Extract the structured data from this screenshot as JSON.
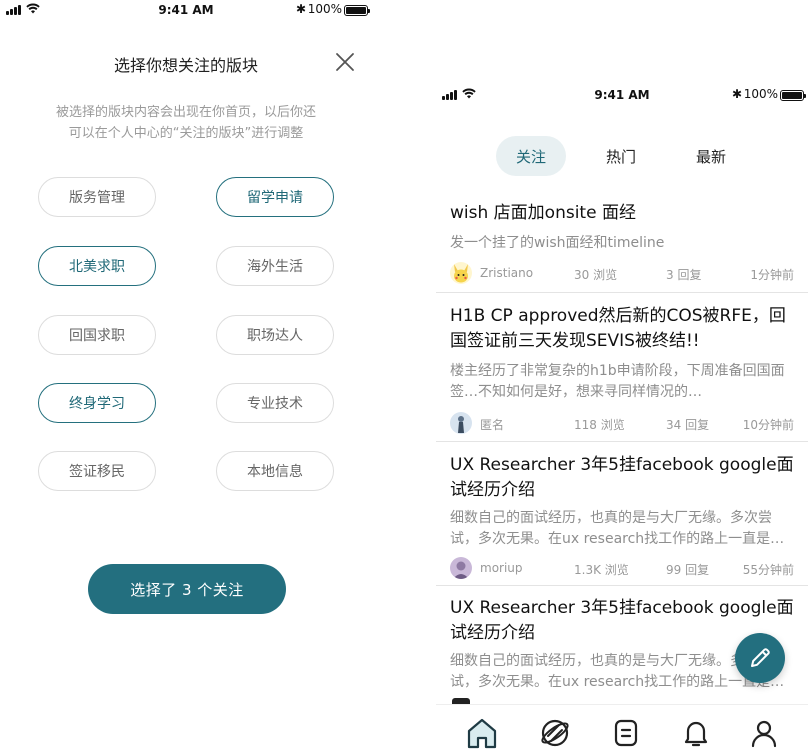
{
  "status_bar": {
    "time": "9:41 AM",
    "battery": "100%",
    "bluetooth": "✱"
  },
  "left": {
    "title": "选择你想关注的版块",
    "desc_line1": "被选择的版块内容会出现在你首页，以后你还",
    "desc_line2": "可以在个人中心的“关注的版块”进行调整",
    "chips": [
      {
        "label": "版务管理",
        "selected": false
      },
      {
        "label": "留学申请",
        "selected": true
      },
      {
        "label": "北美求职",
        "selected": true
      },
      {
        "label": "海外生活",
        "selected": false
      },
      {
        "label": "回国求职",
        "selected": false
      },
      {
        "label": "职场达人",
        "selected": false
      },
      {
        "label": "终身学习",
        "selected": true
      },
      {
        "label": "专业技术",
        "selected": false
      },
      {
        "label": "签证移民",
        "selected": false
      },
      {
        "label": "本地信息",
        "selected": false
      }
    ],
    "confirm_button": "选择了 3 个关注",
    "accent_color": "#236f7f"
  },
  "right": {
    "tabs": [
      {
        "label": "关注",
        "active": true
      },
      {
        "label": "热门",
        "active": false
      },
      {
        "label": "最新",
        "active": false
      }
    ],
    "posts": [
      {
        "title": "wish 店面加onsite 面经",
        "excerpt": "发一个挂了的wish面经和timeline",
        "author": "Zristiano",
        "views": "30 浏览",
        "replies": "3 回复",
        "time": "1分钟前",
        "avatar": "pikachu-avatar"
      },
      {
        "title": "H1B CP approved然后新的COS被RFE，回国签证前三天发现SEVIS被终结!!",
        "excerpt": "楼主经历了非常复杂的h1b申请阶段，下周准备回国面签…不知如何是好，想来寻同样情况的…",
        "author": "匿名",
        "views": "118 浏览",
        "replies": "34 回复",
        "time": "10分钟前",
        "avatar": "anonymous-avatar"
      },
      {
        "title": "UX Researcher 3年5挂facebook google面试经历介绍",
        "excerpt": "细数自己的面试经历，也真的是与大厂无缘。多次尝试，多次无果。在ux research找工作的路上一直是…",
        "author": "moriup",
        "views": "1.3K 浏览",
        "replies": "99 回复",
        "time": "55分钟前",
        "avatar": "user-avatar"
      },
      {
        "title": "UX Researcher 3年5挂facebook google面试经历介绍",
        "excerpt": "细数自己的面试经历，也真的是与大厂无缘。多次尝试，多次无果。在ux research找工作的路上一直是…",
        "author": "",
        "views": "",
        "replies": "",
        "time": "",
        "avatar": ""
      }
    ],
    "nav_icons": [
      "home-icon",
      "explore-icon",
      "forum-icon",
      "bell-icon",
      "profile-icon"
    ]
  }
}
